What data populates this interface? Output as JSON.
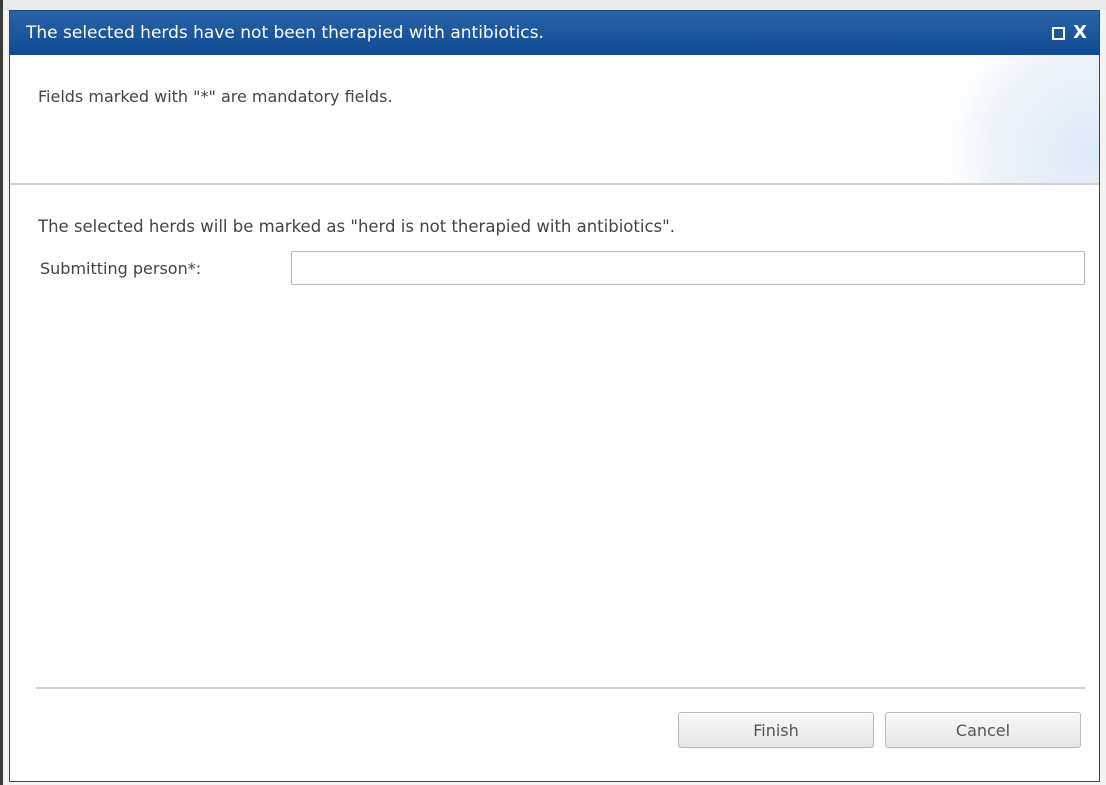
{
  "dialog": {
    "title": "The selected herds have not been therapied with antibiotics.",
    "controls": {
      "maximize_icon": "maximize-icon",
      "close_label": "X"
    },
    "mandatory_note": "Fields marked with \"*\" are mandatory fields.",
    "info_text": "The selected herds will be marked as \"herd is not therapied with antibiotics\".",
    "form": {
      "submitting_person_label": "Submitting person*:",
      "submitting_person_value": "",
      "submitting_person_placeholder": ""
    },
    "buttons": {
      "finish_label": "Finish",
      "cancel_label": "Cancel"
    },
    "colors": {
      "titlebar": "#1a55a0",
      "title_text": "#ffffff"
    }
  }
}
